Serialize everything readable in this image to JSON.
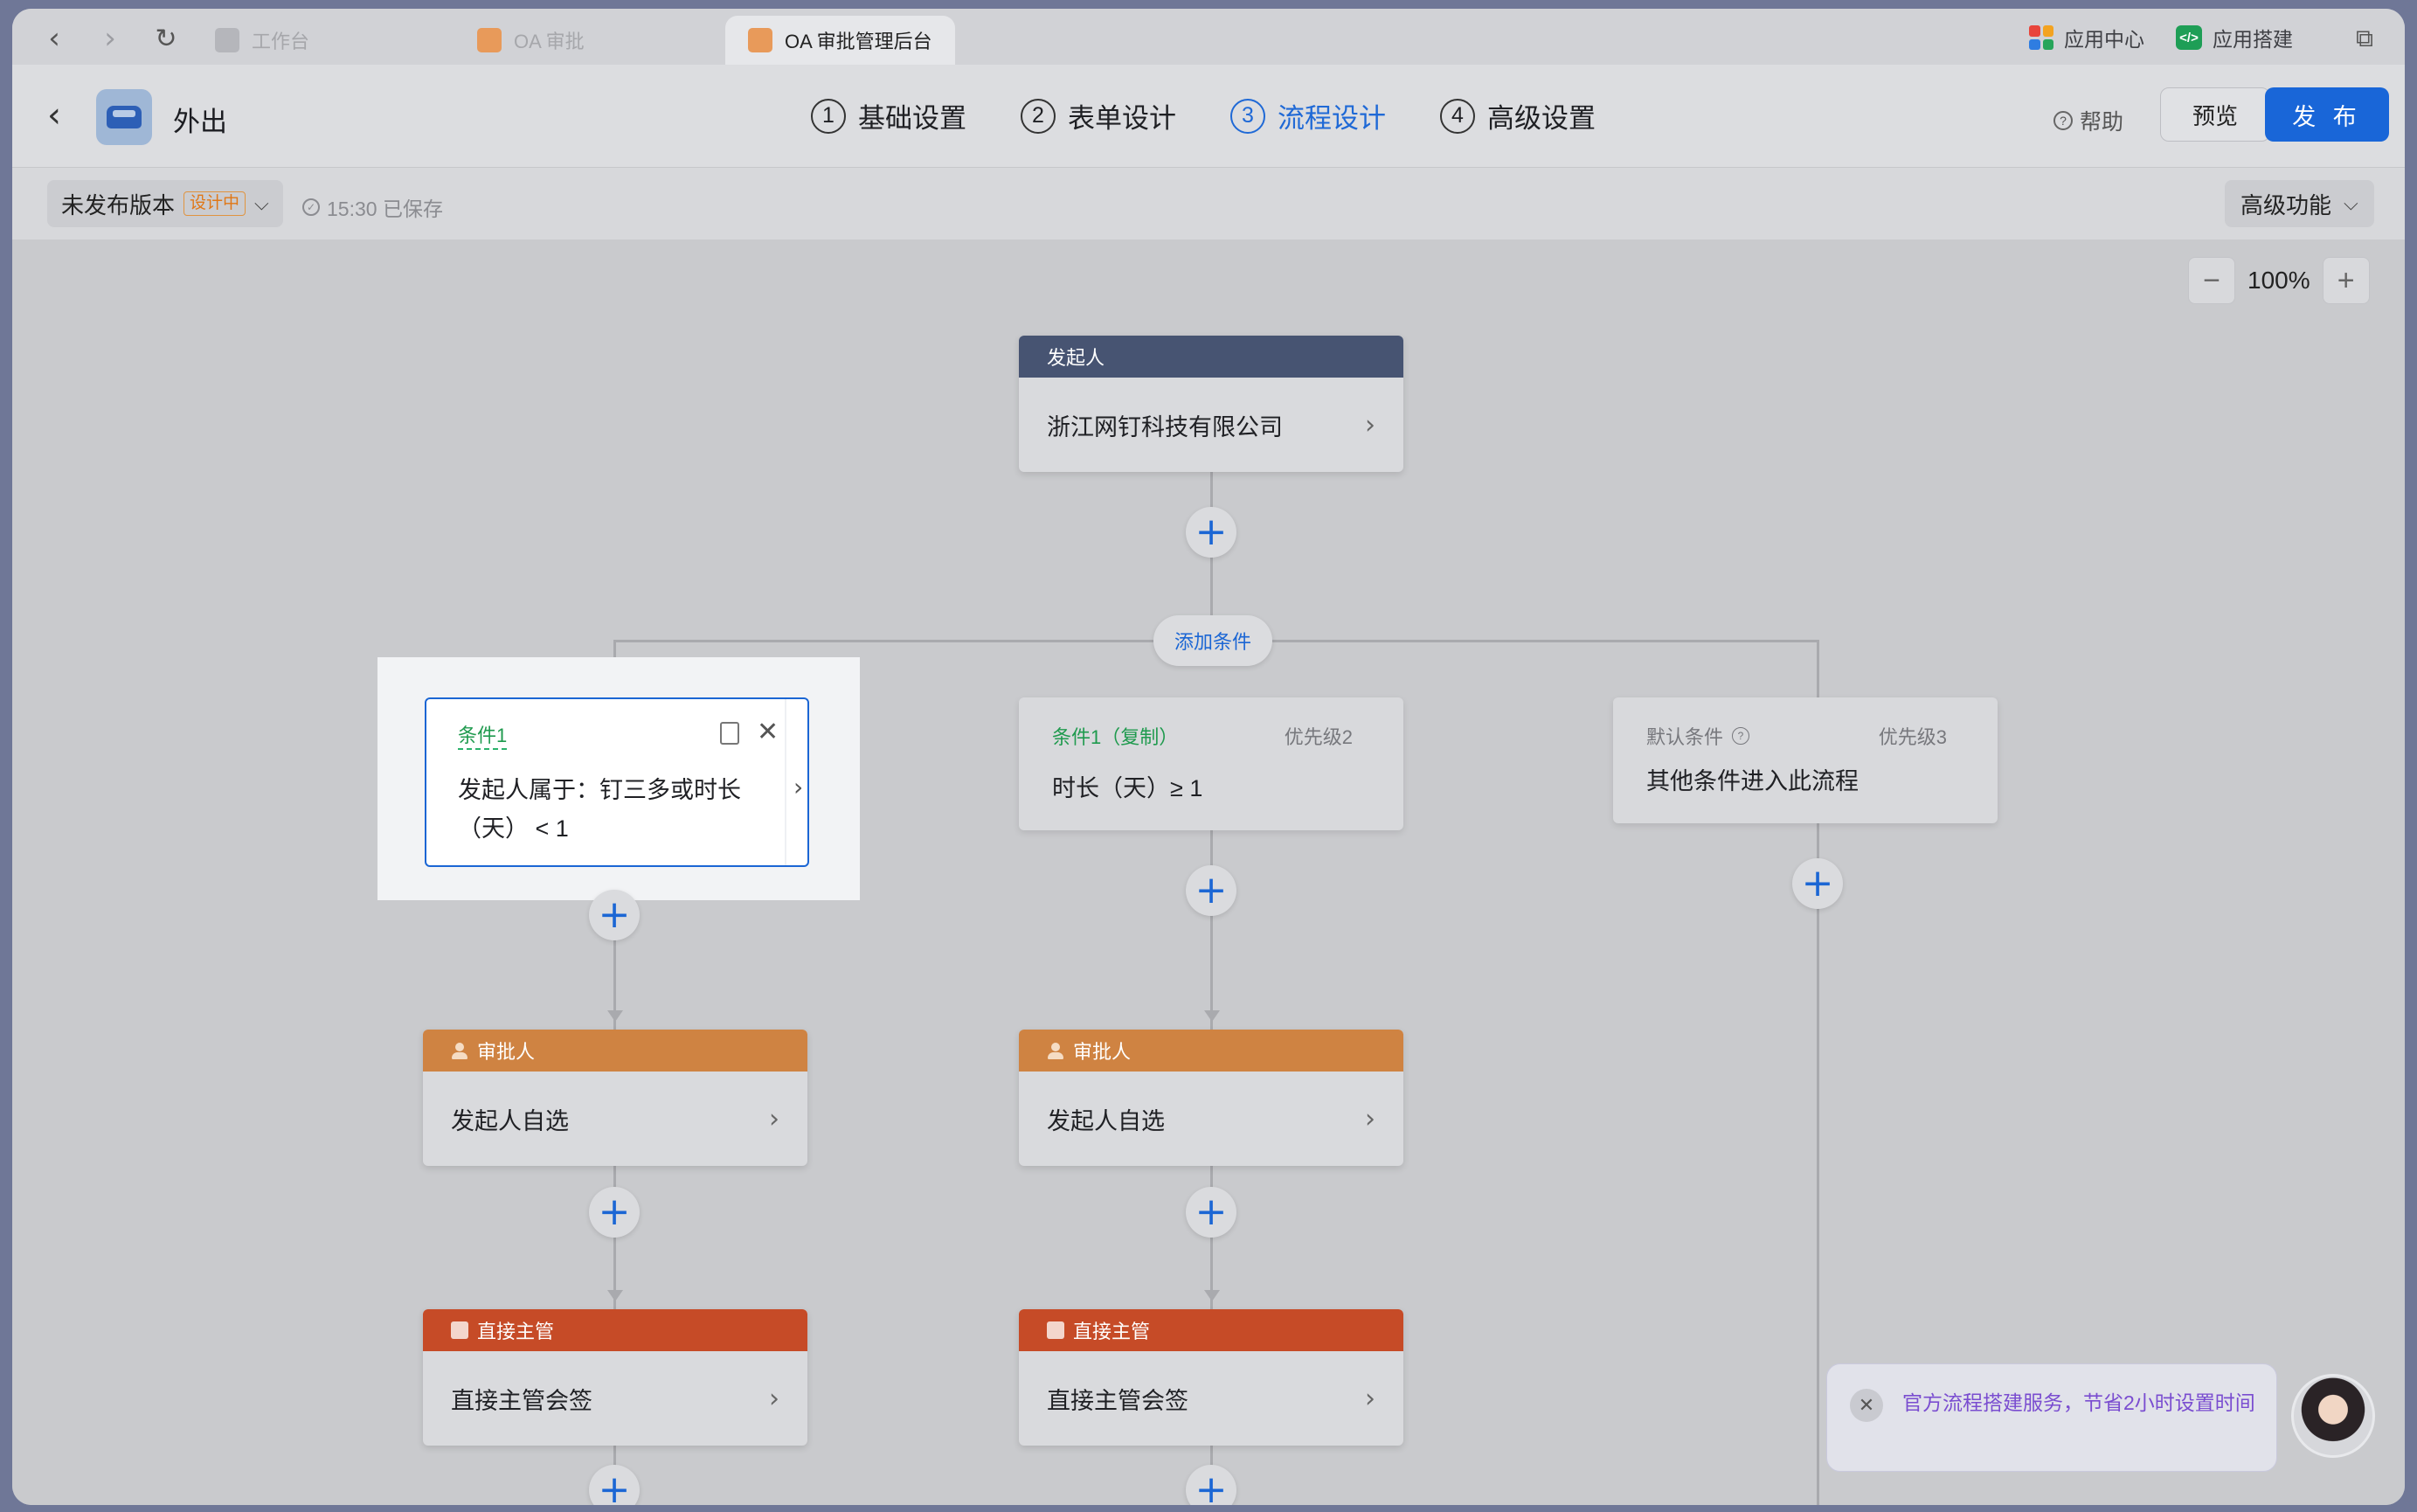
{
  "browser": {
    "tabs": [
      {
        "label": "工作台",
        "active": false
      },
      {
        "label": "OA 审批",
        "active": false
      },
      {
        "label": "OA 审批管理后台",
        "active": true
      }
    ],
    "app_center": "应用中心",
    "app_builder": "应用搭建"
  },
  "header": {
    "app_name": "外出",
    "steps": [
      {
        "num": "1",
        "label": "基础设置",
        "active": false
      },
      {
        "num": "2",
        "label": "表单设计",
        "active": false
      },
      {
        "num": "3",
        "label": "流程设计",
        "active": true
      },
      {
        "num": "4",
        "label": "高级设置",
        "active": false
      }
    ],
    "help": "帮助",
    "preview": "预览",
    "publish": "发 布"
  },
  "toolbar": {
    "version": "未发布版本",
    "version_badge": "设计中",
    "saved": "15:30 已保存",
    "advanced": "高级功能"
  },
  "canvas": {
    "zoom": "100%",
    "add_condition": "添加条件",
    "starter": {
      "head": "发起人",
      "body": "浙江网钉科技有限公司"
    },
    "conditions": [
      {
        "title": "条件1",
        "priority": "",
        "desc": "发起人属于：钉三多或时长（天） < 1"
      },
      {
        "title": "条件1（复制）",
        "priority": "优先级2",
        "desc": "时长（天）≥ 1"
      },
      {
        "title": "默认条件",
        "priority": "优先级3",
        "desc": "其他条件进入此流程"
      }
    ],
    "branches": [
      {
        "approver": {
          "head": "审批人",
          "body": "发起人自选"
        },
        "supervisor": {
          "head": "直接主管",
          "body": "直接主管会签"
        }
      },
      {
        "approver": {
          "head": "审批人",
          "body": "发起人自选"
        },
        "supervisor": {
          "head": "直接主管",
          "body": "直接主管会签"
        }
      }
    ]
  },
  "promo": {
    "text": "官方流程搭建服务，节省2小时设置时间"
  },
  "colors": {
    "accent": "#1966d8",
    "starter": "#475472",
    "approver": "#cf8342",
    "supervisor": "#c64b27",
    "condition": "#1f9a4e"
  }
}
